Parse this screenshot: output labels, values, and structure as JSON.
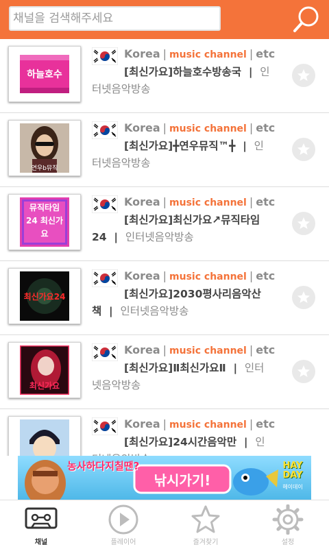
{
  "search": {
    "placeholder": "채널을 검색해주세요"
  },
  "channels": [
    {
      "country": "Korea",
      "category": "music channel",
      "etc": "etc",
      "title": "[최신가요]하늘호수방송국",
      "subtitle": "인터넷음악방송",
      "thumb_label": "하늘호수"
    },
    {
      "country": "Korea",
      "category": "music channel",
      "etc": "etc",
      "title": "[최신가요]╋연우뮤직™╋",
      "subtitle": "인터넷음악방송",
      "thumb_label": "연우b뮤직"
    },
    {
      "country": "Korea",
      "category": "music channel",
      "etc": "etc",
      "title": "[최신가요]최신가요↗뮤직타임24",
      "subtitle": "인터넷음악방송",
      "thumb_label": "뮤직타임 24 최신가요"
    },
    {
      "country": "Korea",
      "category": "music channel",
      "etc": "etc",
      "title": "[최신가요]2030평사리음악산책",
      "subtitle": "인터넷음악방송",
      "thumb_label": "최신가요24"
    },
    {
      "country": "Korea",
      "category": "music channel",
      "etc": "etc",
      "title": "[최신가요]Ⅱ최신가요Ⅱ",
      "subtitle": "인터넷음악방송",
      "thumb_label": "최신가요"
    },
    {
      "country": "Korea",
      "category": "music channel",
      "etc": "etc",
      "title": "[최신가요]24시간음악만",
      "subtitle": "인터넷음악방송",
      "thumb_label": ""
    }
  ],
  "ad": {
    "text1": "농사하다지칠땐?",
    "text2": "낚시가기!",
    "brand": "HAY DAY",
    "brand_sub": "헤이데이"
  },
  "tabs": [
    {
      "label": "채널",
      "icon": "cassette-icon",
      "active": true
    },
    {
      "label": "플레이어",
      "icon": "play-icon",
      "active": false
    },
    {
      "label": "즐겨찾기",
      "icon": "star-icon",
      "active": false
    },
    {
      "label": "설정",
      "icon": "gear-icon",
      "active": false
    }
  ],
  "colors": {
    "accent": "#f4733a",
    "muted": "#8a8a8a"
  }
}
